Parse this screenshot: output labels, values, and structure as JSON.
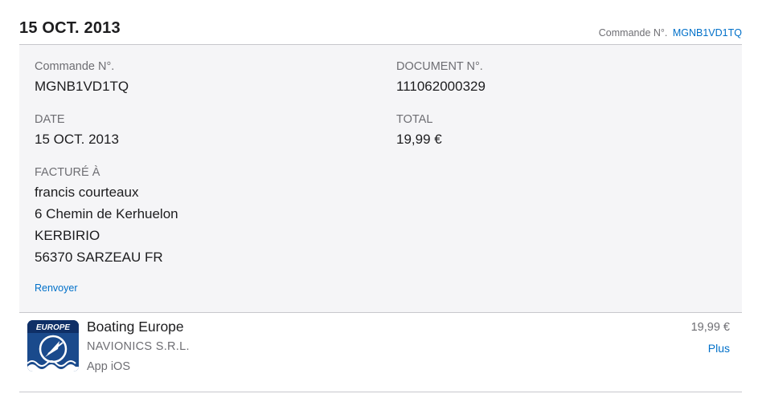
{
  "header": {
    "date": "15 OCT. 2013",
    "order_label": "Commande N°.",
    "order_number": "MGNB1VD1TQ"
  },
  "details": {
    "order_label": "Commande N°.",
    "order_value": "MGNB1VD1TQ",
    "document_label": "DOCUMENT N°.",
    "document_value": "111062000329",
    "date_label": "DATE",
    "date_value": "15 OCT. 2013",
    "total_label": "TOTAL",
    "total_value": "19,99 €",
    "billed_label": "FACTURÉ À",
    "billed_lines": [
      "francis courteaux",
      "6 Chemin de Kerhuelon",
      "KERBIRIO",
      "56370 SARZEAU FR"
    ],
    "resend_label": "Renvoyer"
  },
  "item": {
    "icon_name": "boating-europe-app-icon",
    "icon_text": "EUROPE",
    "name": "Boating Europe",
    "seller": "NAVIONICS S.R.L.",
    "type": "App iOS",
    "price": "19,99 €",
    "more_label": "Plus"
  },
  "colors": {
    "link": "#0070c9",
    "panel_bg": "#f5f5f7",
    "divider": "#c7c7cc",
    "secondary_text": "#6e6e73",
    "primary_text": "#1d1d1f",
    "icon_bg": "#1a4a8c"
  }
}
